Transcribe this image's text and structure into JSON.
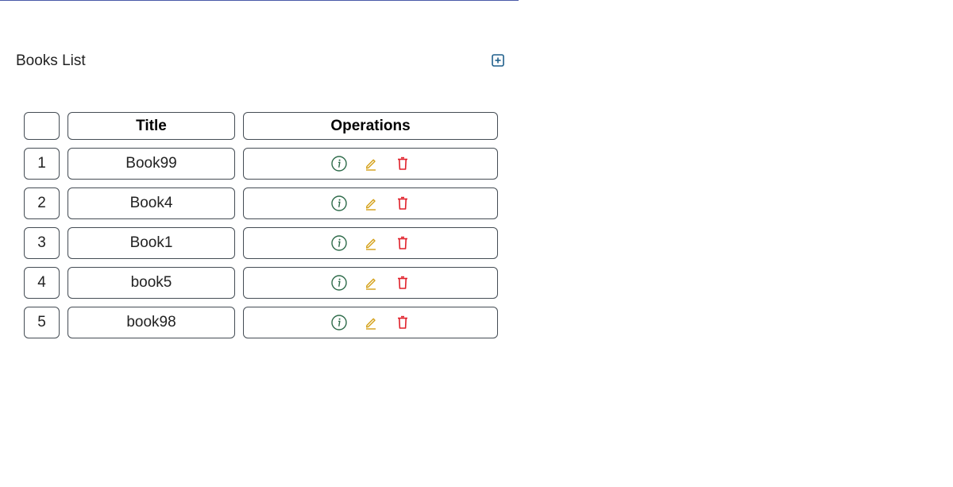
{
  "header": {
    "title": "Books List",
    "add_icon": "plus-square-icon"
  },
  "table": {
    "columns": [
      "",
      "Title",
      "Operations"
    ],
    "rows": [
      {
        "num": "1",
        "title": "Book99"
      },
      {
        "num": "2",
        "title": "Book4"
      },
      {
        "num": "3",
        "title": "Book1"
      },
      {
        "num": "4",
        "title": "book5"
      },
      {
        "num": "5",
        "title": "book98"
      }
    ],
    "operations": [
      "info-icon",
      "edit-icon",
      "delete-icon"
    ]
  },
  "colors": {
    "top_rule": "#4a5aa8",
    "add_icon": "#1f5f8b",
    "info_icon": "#2e6b4a",
    "edit_icon": "#d4a017",
    "delete_icon": "#e0202a",
    "cell_border": "#444c54"
  }
}
